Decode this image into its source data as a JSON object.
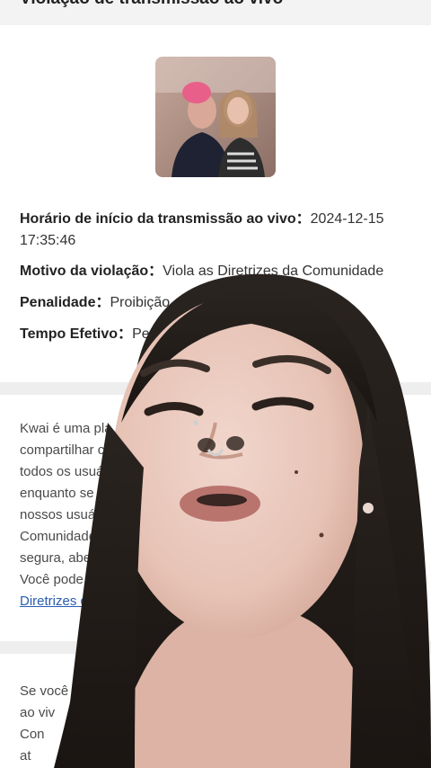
{
  "header": {
    "title": "Violação de transmissão ao vivo"
  },
  "thumbnail": {
    "alt": "stream thumbnail"
  },
  "details": [
    {
      "key": "Horário de início da transmissão ao vivo：",
      "value": "2024-12-15 17:35:46"
    },
    {
      "key": "Motivo da violação：",
      "value": "Viola as Diretrizes da Comunidade"
    },
    {
      "key": "Penalidade：",
      "value": "Proibição"
    },
    {
      "key": "Tempo Efetivo：",
      "value": "Pe"
    }
  ],
  "policy": {
    "lines": [
      "Kwai é uma pla",
      "compartilhar c",
      "todos os usuári",
      "enquanto se d",
      "nossos usuári",
      "Comunidade p",
      "segura, abert",
      "Você pode e"
    ],
    "link": "Diretrizes d"
  },
  "appeal": {
    "lines": [
      "Se você",
      "ao viv",
      "Con",
      "at"
    ]
  },
  "colors": {
    "header_bg": "#f3f3f3",
    "separator": "#eeeeee",
    "link": "#2a5db0"
  }
}
